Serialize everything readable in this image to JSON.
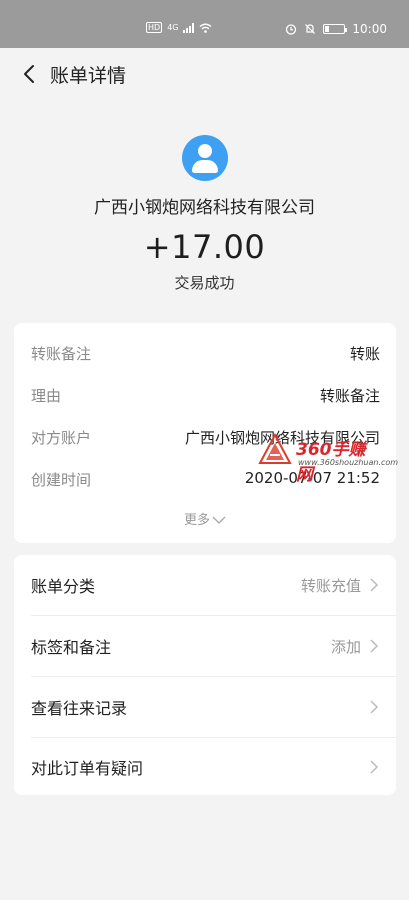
{
  "status_bar": {
    "hd": "HD",
    "network": "4G",
    "time": "10:00"
  },
  "nav": {
    "title": "账单详情"
  },
  "header": {
    "merchant": "广西小钢炮网络科技有限公司",
    "amount": "+17.00",
    "status": "交易成功"
  },
  "details": [
    {
      "label": "转账备注",
      "value": "转账"
    },
    {
      "label": "理由",
      "value": "转账备注"
    },
    {
      "label": "对方账户",
      "value": "广西小钢炮网络科技有限公司"
    },
    {
      "label": "创建时间",
      "value": "2020-07-07 21:52"
    }
  ],
  "more_label": "更多",
  "actions": [
    {
      "label": "账单分类",
      "value": "转账充值"
    },
    {
      "label": "标签和备注",
      "value": "添加"
    },
    {
      "label": "查看往来记录",
      "value": ""
    },
    {
      "label": "对此订单有疑问",
      "value": ""
    }
  ],
  "watermark": {
    "text": "360手赚网",
    "url": "www.360shouzhuan.com"
  },
  "colors": {
    "accent": "#3ea0f2",
    "statusbar": "#9b9b9b",
    "background": "#f3f3f3"
  }
}
